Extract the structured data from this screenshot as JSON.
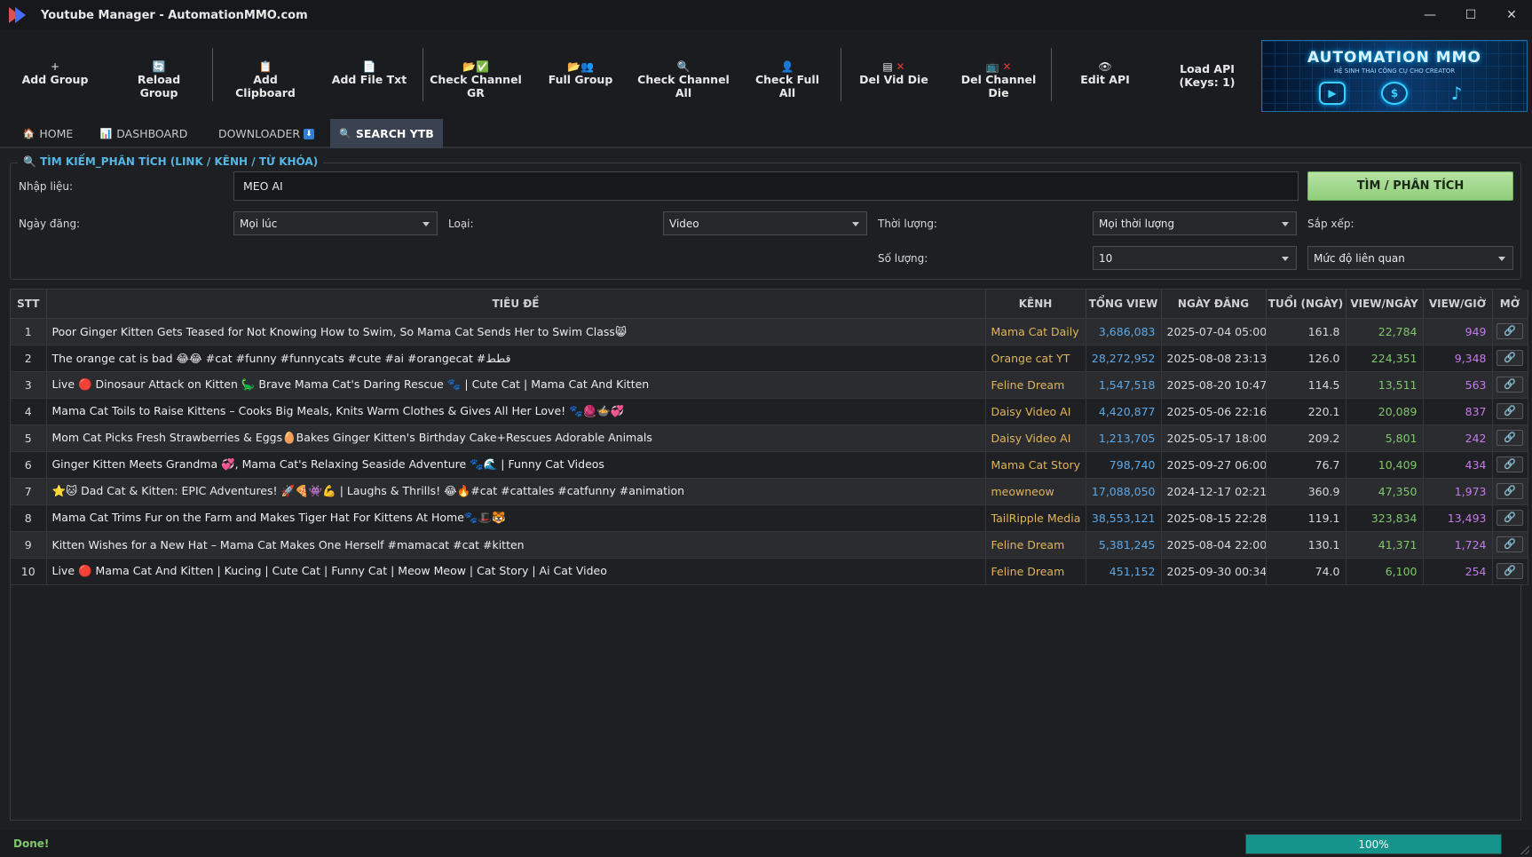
{
  "window": {
    "title": "Youtube Manager - AutomationMMO.com",
    "controls": {
      "minimize": "—",
      "maximize": "☐",
      "close": "✕"
    }
  },
  "toolbar": {
    "add_group": "Add Group",
    "reload_group": "Reload Group",
    "add_clipboard": "Add Clipboard",
    "add_file_txt": "Add File Txt",
    "check_channel_gr": "Check Channel GR",
    "full_group": "Full Group",
    "check_channel_all": "Check Channel All",
    "check_full_all": "Check Full All",
    "del_vid_die": "Del Vid Die",
    "del_channel_die": "Del Channel Die",
    "edit_api": "Edit API",
    "load_api_line1": "Load API",
    "load_api_line2": "(Keys: 1)",
    "icons": {
      "add": "+",
      "reload": "🔄",
      "clipboard": "📋",
      "file": "📄",
      "folder": "📂",
      "check": "✅",
      "people": "👥",
      "search": "🔍",
      "person": "👤",
      "list": "▤",
      "cross": "✕",
      "tv": "📺",
      "eye": "👁"
    }
  },
  "banner": {
    "title": "AUTOMATION MMO",
    "subtitle": "HỆ SINH THÁI CÔNG CỤ CHO CREATOR"
  },
  "tabs": [
    {
      "label": "HOME",
      "icon": "🏠"
    },
    {
      "label": "DASHBOARD",
      "icon": "📊"
    },
    {
      "label": "DOWNLOADER",
      "icon": ""
    },
    {
      "label": "SEARCH YTB",
      "icon": "🔍"
    }
  ],
  "search_panel": {
    "title": "TÌM KIẾM_PHÂN TÍCH (LINK / KÊNH / TỪ KHÓA)",
    "input_label": "Nhập liệu:",
    "input_value": "MEO AI",
    "search_button": "TÌM / PHÂN TÍCH",
    "date_label": "Ngày đăng:",
    "date_value": "Mọi lúc",
    "type_label": "Loại:",
    "type_value": "Video",
    "duration_label": "Thời lượng:",
    "duration_value": "Mọi thời lượng",
    "sort_label": "Sắp xếp:",
    "quantity_label": "Số lượng:",
    "quantity_value": "10",
    "sort_value": "Mức độ liên quan"
  },
  "table": {
    "headers": [
      "STT",
      "TIÊU ĐỀ",
      "KÊNH",
      "TỔNG VIEW",
      "NGÀY ĐĂNG",
      "TUỔI (NGÀY)",
      "VIEW/NGÀY",
      "VIEW/GIỜ",
      "MỞ"
    ],
    "open_icon": "🔗",
    "rows": [
      {
        "stt": "1",
        "title": "Poor Ginger Kitten Gets Teased for Not Knowing How to Swim, So Mama Cat Sends Her to Swim Class😸",
        "channel": "Mama Cat Daily",
        "views": "3,686,083",
        "date": "2025-07-04 05:00",
        "age": "161.8",
        "vpd": "22,784",
        "vph": "949"
      },
      {
        "stt": "2",
        "title": "The orange cat is bad 😂😂 #cat #funny #funnycats #cute #ai #orangecat #قطط",
        "channel": "Orange cat YT",
        "views": "28,272,952",
        "date": "2025-08-08 23:13",
        "age": "126.0",
        "vpd": "224,351",
        "vph": "9,348"
      },
      {
        "stt": "3",
        "title": "Live 🔴 Dinosaur Attack on Kitten 🦕 Brave Mama Cat's Daring Rescue 🐾 | Cute Cat | Mama Cat And Kitten",
        "channel": "Feline Dream",
        "views": "1,547,518",
        "date": "2025-08-20 10:47",
        "age": "114.5",
        "vpd": "13,511",
        "vph": "563"
      },
      {
        "stt": "4",
        "title": "Mama Cat Toils to Raise Kittens – Cooks Big Meals, Knits Warm Clothes & Gives All Her Love! 🐾🧶🍲💞",
        "channel": "Daisy Video AI",
        "views": "4,420,877",
        "date": "2025-05-06 22:16",
        "age": "220.1",
        "vpd": "20,089",
        "vph": "837"
      },
      {
        "stt": "5",
        "title": "Mom Cat Picks Fresh Strawberries & Eggs🥚Bakes Ginger Kitten's Birthday Cake+Rescues Adorable Animals",
        "channel": "Daisy Video AI",
        "views": "1,213,705",
        "date": "2025-05-17 18:00",
        "age": "209.2",
        "vpd": "5,801",
        "vph": "242"
      },
      {
        "stt": "6",
        "title": "Ginger Kitten Meets Grandma 💞, Mama Cat's Relaxing Seaside Adventure 🐾🌊 | Funny Cat Videos",
        "channel": "Mama Cat Story",
        "views": "798,740",
        "date": "2025-09-27 06:00",
        "age": "76.7",
        "vpd": "10,409",
        "vph": "434"
      },
      {
        "stt": "7",
        "title": "⭐🐱 Dad Cat & Kitten: EPIC Adventures! 🚀🍕👾💪 | Laughs & Thrills! 😂🔥#cat #cattales #catfunny #animation",
        "channel": "meowneow",
        "views": "17,088,050",
        "date": "2024-12-17 02:21",
        "age": "360.9",
        "vpd": "47,350",
        "vph": "1,973"
      },
      {
        "stt": "8",
        "title": "Mama Cat Trims Fur on the Farm and Makes Tiger Hat For Kittens At Home🐾🎩🐯",
        "channel": "TailRipple Media",
        "views": "38,553,121",
        "date": "2025-08-15 22:28",
        "age": "119.1",
        "vpd": "323,834",
        "vph": "13,493"
      },
      {
        "stt": "9",
        "title": "Kitten Wishes for a New Hat – Mama Cat Makes One Herself #mamacat #cat #kitten",
        "channel": "Feline Dream",
        "views": "5,381,245",
        "date": "2025-08-04 22:00",
        "age": "130.1",
        "vpd": "41,371",
        "vph": "1,724"
      },
      {
        "stt": "10",
        "title": "Live 🔴 Mama Cat And Kitten | Kucing | Cute Cat | Funny Cat | Meow Meow | Cat Story | Ai Cat Video",
        "channel": "Feline Dream",
        "views": "451,152",
        "date": "2025-09-30 00:34",
        "age": "74.0",
        "vpd": "6,100",
        "vph": "254"
      }
    ]
  },
  "status": {
    "text": "Done!",
    "progress_percent": 100,
    "progress_label": "100%"
  }
}
